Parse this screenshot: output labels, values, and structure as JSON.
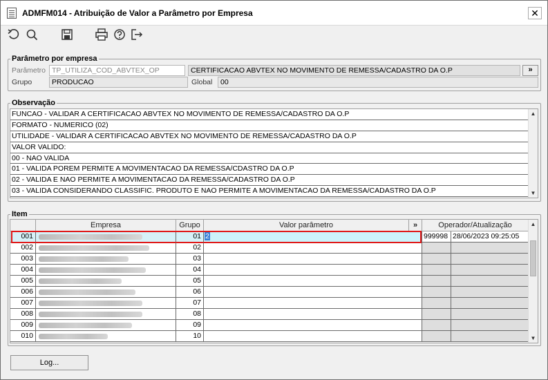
{
  "window": {
    "title": "ADMFM014 - Atribuição de Valor a Parâmetro por Empresa",
    "close_label": "✕"
  },
  "toolbar": {
    "icons": [
      "refresh-icon",
      "search-icon",
      "save-icon",
      "print-icon",
      "help-icon",
      "exit-icon"
    ]
  },
  "parametro_panel": {
    "title": "Parâmetro por empresa",
    "parametro_label": "Parâmetro",
    "parametro_value": "TP_UTILIZA_COD_ABVTEX_OP",
    "parametro_desc": "CERTIFICACAO ABVTEX  NO MOVIMENTO DE REMESSA/CADASTRO DA O.P",
    "more_label": "»",
    "grupo_label": "Grupo",
    "grupo_value": "PRODUCAO",
    "global_label": "Global",
    "global_value": "00"
  },
  "observacao": {
    "title": "Observação",
    "lines": [
      "FUNCAO - VALIDAR A CERTIFICACAO ABVTEX NO MOVIMENTO DE REMESSA/CADASTRO DA O.P",
      "FORMATO - NUMERICO (02)",
      "UTILIDADE - VALIDAR A CERTIFICACAO ABVTEX NO MOVIMENTO DE REMESSA/CADASTRO DA O.P",
      "VALOR VALIDO:",
      "00 - NAO VALIDA",
      "01 - VALIDA POREM PERMITE A MOVIMENTACAO DA REMESSA/CDASTRO DA O.P",
      "02 - VALIDA E NAO PERMITE A MOVIMENTACAO DA REMESSA/CADASTRO DA O.P",
      "03 - VALIDA CONSIDERANDO CLASSIFIC. PRODUTO E NAO PERMITE A MOVIMENTACAO DA REMESSA/CADASTRO DA O.P"
    ]
  },
  "item": {
    "title": "Item",
    "columns": {
      "empresa": "Empresa",
      "grupo": "Grupo",
      "valor": "Valor parâmetro",
      "more": "»",
      "operador": "Operador/Atualização"
    },
    "rows": [
      {
        "code": "001",
        "grupo": "01",
        "valor": "2",
        "operador": "999998",
        "atualizacao": "28/06/2023 09:25:05",
        "selected": true
      },
      {
        "code": "002",
        "grupo": "02",
        "valor": "",
        "operador": "",
        "atualizacao": ""
      },
      {
        "code": "003",
        "grupo": "03",
        "valor": "",
        "operador": "",
        "atualizacao": ""
      },
      {
        "code": "004",
        "grupo": "04",
        "valor": "",
        "operador": "",
        "atualizacao": ""
      },
      {
        "code": "005",
        "grupo": "05",
        "valor": "",
        "operador": "",
        "atualizacao": ""
      },
      {
        "code": "006",
        "grupo": "06",
        "valor": "",
        "operador": "",
        "atualizacao": ""
      },
      {
        "code": "007",
        "grupo": "07",
        "valor": "",
        "operador": "",
        "atualizacao": ""
      },
      {
        "code": "008",
        "grupo": "08",
        "valor": "",
        "operador": "",
        "atualizacao": ""
      },
      {
        "code": "009",
        "grupo": "09",
        "valor": "",
        "operador": "",
        "atualizacao": ""
      },
      {
        "code": "010",
        "grupo": "10",
        "valor": "",
        "operador": "",
        "atualizacao": ""
      }
    ]
  },
  "footer": {
    "log_label": "Log..."
  }
}
